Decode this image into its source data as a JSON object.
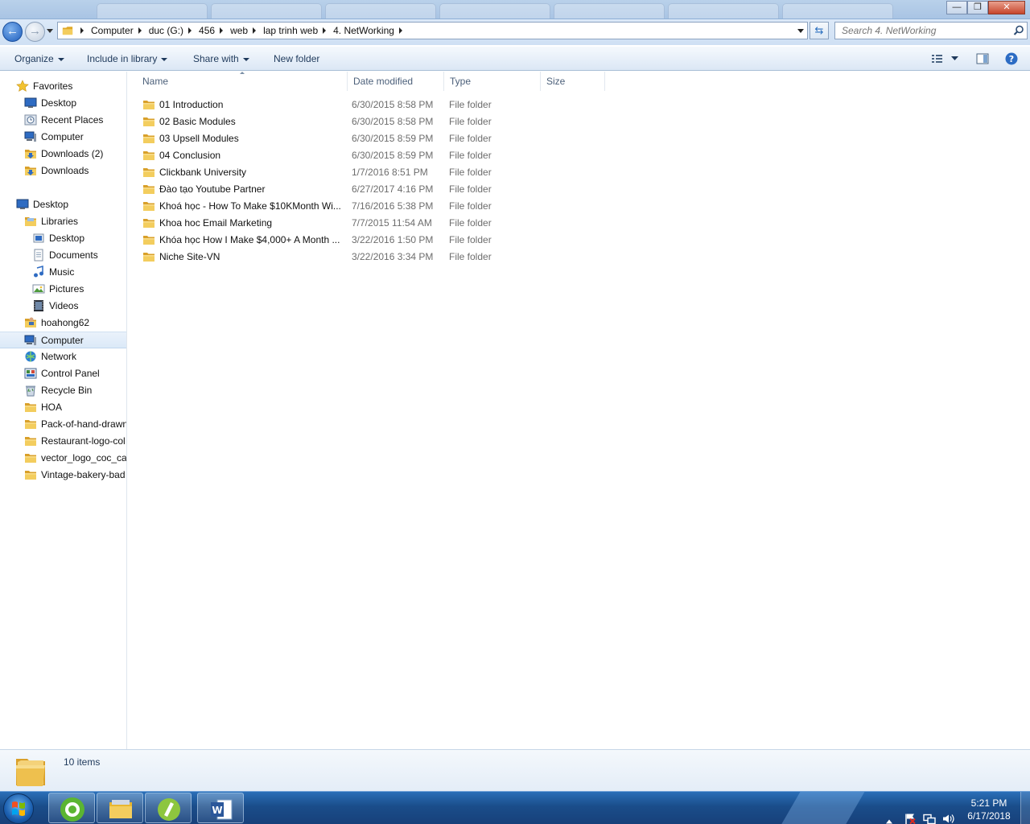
{
  "window": {
    "minimize": "—",
    "maximize": "❐",
    "close": "✕"
  },
  "address": {
    "crumbs": [
      "Computer",
      "duc (G:)",
      "456",
      "web",
      "lap trinh web",
      "4. NetWorking"
    ]
  },
  "search": {
    "placeholder": "Search 4. NetWorking"
  },
  "commands": {
    "organize": "Organize",
    "include_in_library": "Include in library",
    "share_with": "Share with",
    "new_folder": "New folder"
  },
  "nav": {
    "favorites": "Favorites",
    "favorites_items": [
      "Desktop",
      "Recent Places",
      "Computer",
      "Downloads (2)",
      "Downloads"
    ],
    "desktop": "Desktop",
    "libraries": "Libraries",
    "libraries_items": [
      "Desktop",
      "Documents",
      "Music",
      "Pictures",
      "Videos"
    ],
    "desktop_items": [
      "hoahong62",
      "Computer",
      "Network",
      "Control Panel",
      "Recycle Bin",
      "HOA",
      "Pack-of-hand-drawn",
      "Restaurant-logo-col",
      "vector_logo_coc_caf",
      "Vintage-bakery-bad"
    ]
  },
  "columns": {
    "name": "Name",
    "date_modified": "Date modified",
    "type": "Type",
    "size": "Size"
  },
  "files": [
    {
      "name": "01 Introduction",
      "date": "6/30/2015 8:58 PM",
      "type": "File folder"
    },
    {
      "name": "02 Basic Modules",
      "date": "6/30/2015 8:58 PM",
      "type": "File folder"
    },
    {
      "name": "03 Upsell Modules",
      "date": "6/30/2015 8:59 PM",
      "type": "File folder"
    },
    {
      "name": "04 Conclusion",
      "date": "6/30/2015 8:59 PM",
      "type": "File folder"
    },
    {
      "name": "Clickbank University",
      "date": "1/7/2016 8:51 PM",
      "type": "File folder"
    },
    {
      "name": "Đào tạo Youtube Partner",
      "date": "6/27/2017 4:16 PM",
      "type": "File folder"
    },
    {
      "name": "Khoá học - How To Make $10KMonth Wi...",
      "date": "7/16/2016 5:38 PM",
      "type": "File folder"
    },
    {
      "name": "Khoa hoc Email Marketing",
      "date": "7/7/2015 11:54 AM",
      "type": "File folder"
    },
    {
      "name": "Khóa học How I Make $4,000+ A Month ...",
      "date": "3/22/2016 1:50 PM",
      "type": "File folder"
    },
    {
      "name": "Niche Site-VN",
      "date": "3/22/2016 3:34 PM",
      "type": "File folder"
    }
  ],
  "status": {
    "item_count": "10 items"
  },
  "taskbar": {
    "time": "5:21 PM",
    "date": "6/17/2018"
  },
  "colors": {
    "folder": "#e8b630",
    "accent": "#1e395b",
    "taskbar": "#1a4d8a"
  }
}
